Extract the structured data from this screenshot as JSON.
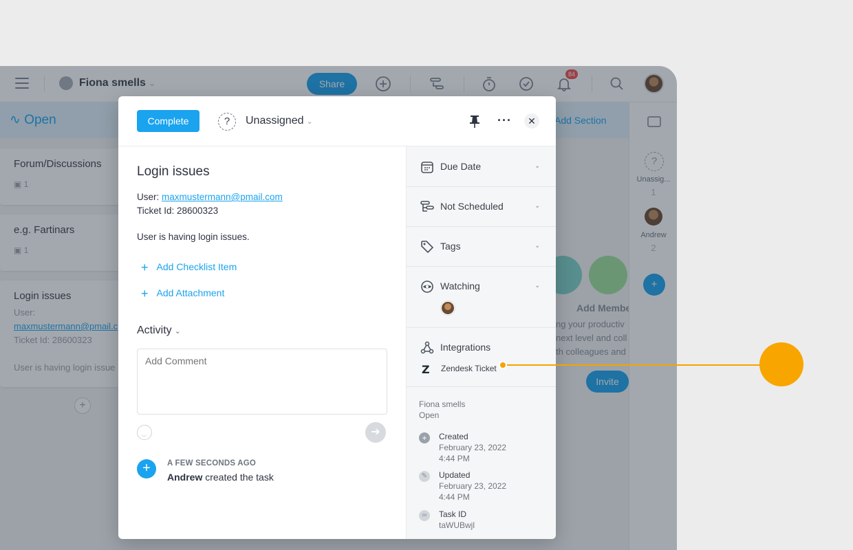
{
  "topbar": {
    "project_name": "Fiona smells",
    "share_label": "Share",
    "notification_count": "84"
  },
  "board": {
    "section_title": "Open",
    "add_section_label": "Add Section",
    "cards": [
      {
        "title": "Forum/Discussions",
        "comment_count": "1"
      },
      {
        "title": "e.g. Fartinars",
        "comment_count": "1"
      },
      {
        "title": "Login issues",
        "line1": "User:",
        "email": "maxmustermann@pmail.c",
        "line2": "Ticket Id: 28600323",
        "line3": "User is having login issue"
      }
    ],
    "add_member_title": "Add Membe",
    "add_member_desc": [
      "ng your productiv",
      "next level and coll",
      "th colleagues and"
    ],
    "invite_label": "Invite"
  },
  "rail": {
    "unassigned_label": "Unassig...",
    "unassigned_count": "1",
    "andrew_label": "Andrew",
    "andrew_count": "2"
  },
  "modal": {
    "complete_label": "Complete",
    "assignee": "Unassigned",
    "title": "Login issues",
    "user_prefix": "User: ",
    "user_email": "maxmustermann@pmail.com",
    "ticket_line": "Ticket Id: 28600323",
    "description": "User is having login issues.",
    "add_checklist": "Add Checklist Item",
    "add_attachment": "Add Attachment",
    "activity_label": "Activity",
    "comment_placeholder": "Add Comment",
    "activity_time": "A FEW SECONDS AGO",
    "activity_user": "Andrew",
    "activity_action": " created the task",
    "props": {
      "due_date": "Due Date",
      "schedule": "Not Scheduled",
      "tags": "Tags",
      "watching": "Watching",
      "integrations": "Integrations",
      "zendesk": "Zendesk Ticket"
    },
    "info": {
      "project": "Fiona smells",
      "section": "Open",
      "created_label": "Created",
      "created_date": "February 23, 2022",
      "created_time": "4:44 PM",
      "updated_label": "Updated",
      "updated_date": "February 23, 2022",
      "updated_time": "4:44 PM",
      "taskid_label": "Task ID",
      "taskid_value": "taWUBwjl"
    }
  },
  "colors": {
    "accent": "#1aa3ee",
    "pointer": "#f8a500",
    "badge": "#f04e4e"
  }
}
